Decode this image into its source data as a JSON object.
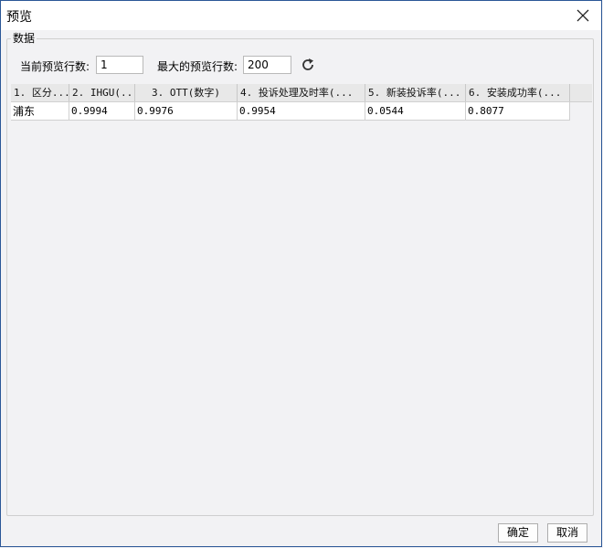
{
  "window": {
    "title": "预览"
  },
  "group": {
    "label": "数据"
  },
  "controls": {
    "current_rows_label": "当前预览行数:",
    "current_rows_value": "1",
    "max_rows_label": "最大的预览行数:",
    "max_rows_value": "200",
    "refresh_icon": "refresh-icon"
  },
  "table": {
    "columns": [
      "1. 区分...",
      "2. IHGU(...",
      "3. OTT(数字)",
      "4. 投诉处理及时率(...",
      "5. 新装投诉率(...",
      "6. 安装成功率(..."
    ],
    "rows": [
      [
        "浦东",
        "0.9994",
        "0.9976",
        "0.9954",
        "0.0544",
        "0.8077"
      ]
    ]
  },
  "footer": {
    "ok_label": "确定",
    "cancel_label": "取消"
  }
}
